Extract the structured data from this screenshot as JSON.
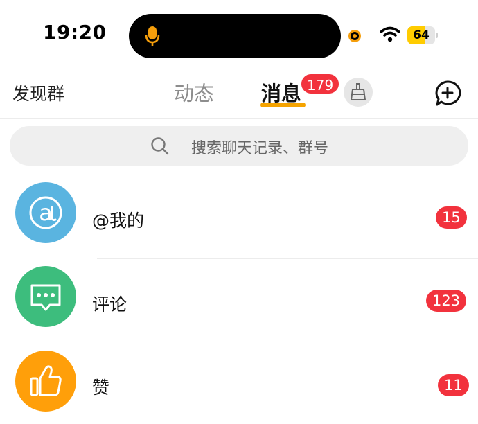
{
  "status_bar": {
    "time": "19:20",
    "battery_level": "64",
    "battery_percent": 64,
    "accent_color": "#f59e0b"
  },
  "nav": {
    "left_label": "发现群",
    "tabs": [
      {
        "label": "动态",
        "active": false
      },
      {
        "label": "消息",
        "active": true,
        "badge": "179"
      }
    ],
    "clean_icon": "broom-icon",
    "compose_icon": "chat-plus-icon",
    "active_underline_color": "#f5a300"
  },
  "search": {
    "placeholder": "搜索聊天记录、群号",
    "icon": "search-icon"
  },
  "list": {
    "items": [
      {
        "label": "@我的",
        "badge": "15",
        "icon": "at-icon",
        "color": "#5ab4e0"
      },
      {
        "label": "评论",
        "badge": "123",
        "icon": "comment-icon",
        "color": "#3dbd7d"
      },
      {
        "label": "赞",
        "badge": "11",
        "icon": "thumbs-up-icon",
        "color": "#ff9f0a"
      }
    ]
  },
  "colors": {
    "badge_red": "#f2323d"
  }
}
